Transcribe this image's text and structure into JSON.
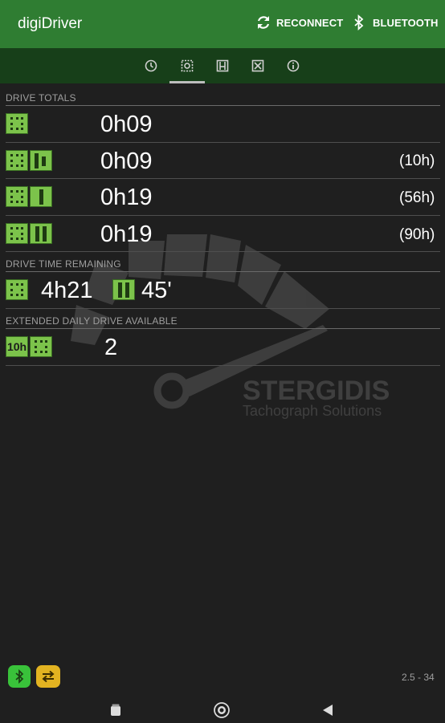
{
  "appbar": {
    "title": "digiDriver",
    "reconnect_label": "RECONNECT",
    "bluetooth_label": "BLUETOOTH",
    "color": "#2f7d32"
  },
  "tabs": [
    {
      "icon": "clock-icon",
      "selected": false
    },
    {
      "icon": "steering-icon",
      "selected": true
    },
    {
      "icon": "bed-icon",
      "selected": false
    },
    {
      "icon": "crossed-hammers-icon",
      "selected": false
    },
    {
      "icon": "info-icon",
      "selected": false
    }
  ],
  "drive_totals": {
    "header": "DRIVE TOTALS",
    "rows": [
      {
        "value": "0h09",
        "extra": ""
      },
      {
        "value": "0h09",
        "extra": "(10h)"
      },
      {
        "value": "0h19",
        "extra": "(56h)"
      },
      {
        "value": "0h19",
        "extra": "(90h)"
      }
    ]
  },
  "drive_time_remaining": {
    "header": "DRIVE TIME REMAINING",
    "drive_value": "4h21",
    "break_value": "45'"
  },
  "extended_daily_drive": {
    "header": "EXTENDED DAILY DRIVE AVAILABLE",
    "badge_label": "10h",
    "value": "2"
  },
  "watermark": {
    "brand": "STERGIDIS",
    "tagline": "Tachograph Solutions"
  },
  "footer": {
    "version": "2.5 - 34"
  },
  "colors": {
    "badge_green": "#7cc34b",
    "bluetooth_button": "#39c23a",
    "switch_button": "#e2b321"
  }
}
